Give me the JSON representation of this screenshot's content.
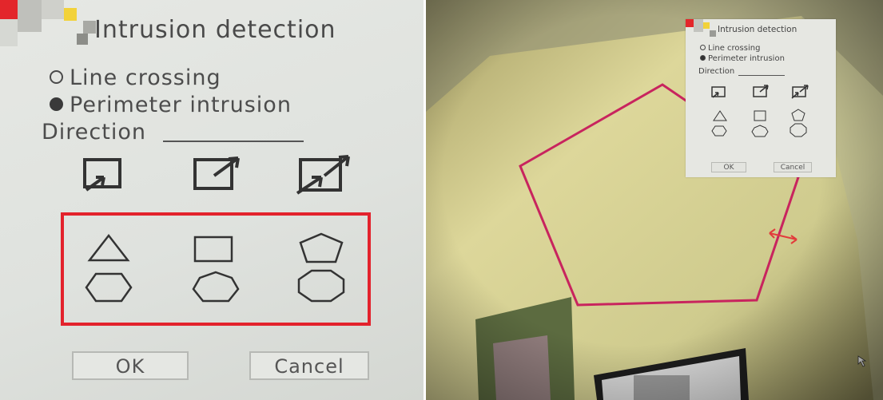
{
  "dialog": {
    "title": "Intrusion detection",
    "options": [
      {
        "label": "Line crossing",
        "selected": false
      },
      {
        "label": "Perimeter intrusion",
        "selected": true
      }
    ],
    "direction_label": "Direction",
    "direction_icons": [
      "enter-region-icon",
      "exit-region-icon",
      "bidirectional-region-icon"
    ],
    "shape_icons": [
      "triangle-icon",
      "square-icon",
      "pentagon-icon",
      "hexagon-icon",
      "heptagon-icon",
      "octagon-icon"
    ],
    "ok_label": "OK",
    "cancel_label": "Cancel"
  },
  "colors": {
    "highlight_border": "#e3222c",
    "polygon_line": "#c8245e",
    "arrow": "#e23b3b",
    "dialog_bg": "#e3e5e1"
  },
  "scene": {
    "overlay_polygon": "pentagon"
  }
}
